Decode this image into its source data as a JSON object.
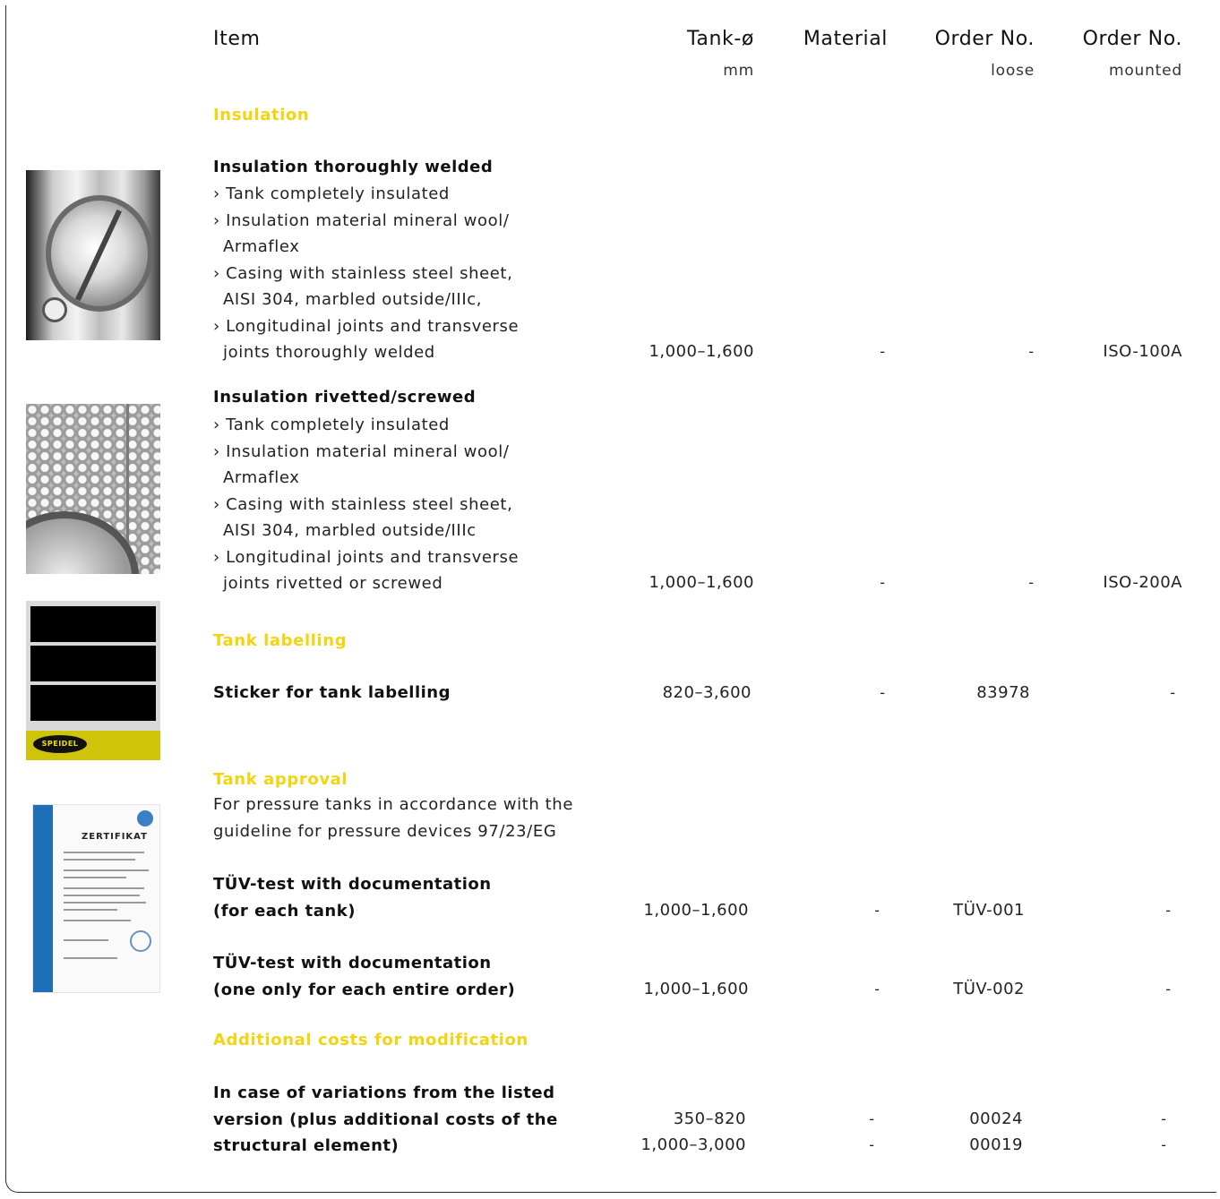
{
  "header": {
    "item": "Item",
    "tank": "Tank-ø",
    "tank_unit": "mm",
    "material": "Material",
    "order_loose": "Order No.",
    "order_loose_sub": "loose",
    "order_mounted": "Order No.",
    "order_mounted_sub": "mounted"
  },
  "sections": {
    "insulation": "Insulation",
    "labelling": "Tank labelling",
    "approval": "Tank approval",
    "additional": "Additional costs for modification"
  },
  "items": {
    "iso_welded": {
      "title": "Insulation thoroughly welded",
      "lines": [
        "› Tank completely insulated",
        "› Insulation material mineral wool/",
        "Armaflex",
        "› Casing with stainless steel sheet,",
        "AISI 304, marbled outside/IIIc,",
        "› Longitudinal joints and transverse",
        "joints thoroughly welded"
      ],
      "tank": "1,000–1,600",
      "material": "-",
      "loose": "-",
      "mounted": "ISO-100A"
    },
    "iso_rivet": {
      "title": "Insulation rivetted/screwed",
      "lines": [
        "› Tank completely insulated",
        "› Insulation material mineral wool/",
        "Armaflex",
        "› Casing with stainless steel sheet,",
        "AISI 304, marbled outside/IIIc",
        "› Longitudinal joints and transverse",
        "joints rivetted or screwed"
      ],
      "tank": "1,000–1,600",
      "material": "-",
      "loose": "-",
      "mounted": "ISO-200A"
    },
    "sticker": {
      "title": "Sticker for tank labelling",
      "tank": "820–3,600",
      "material": "-",
      "loose": "83978",
      "mounted": "-"
    },
    "approval_desc": [
      "For pressure tanks in accordance with the",
      "guideline for pressure devices 97/23/EG"
    ],
    "tuv1": {
      "title_lines": [
        "TÜV-test with documentation",
        "(for each tank)"
      ],
      "tank": "1,000–1,600",
      "material": "-",
      "loose": "TÜV-001",
      "mounted": "-"
    },
    "tuv2": {
      "title_lines": [
        "TÜV-test with documentation",
        "(one only for each entire order)"
      ],
      "tank": "1,000–1,600",
      "material": "-",
      "loose": "TÜV-002",
      "mounted": "-"
    },
    "modification": {
      "title_lines": [
        "In case of variations from the listed",
        "version (plus additional costs of the",
        "structural element)"
      ],
      "tank": [
        "350–820",
        "1,000–3,000"
      ],
      "material": [
        "-",
        "-"
      ],
      "loose": [
        "00024",
        "00019"
      ],
      "mounted": [
        "-",
        "-"
      ]
    }
  },
  "images": {
    "sticker_logo": "SPEIDEL",
    "cert_title": "ZERTIFIKAT"
  },
  "colors": {
    "section_heading": "#f2d410",
    "text": "#111111"
  }
}
